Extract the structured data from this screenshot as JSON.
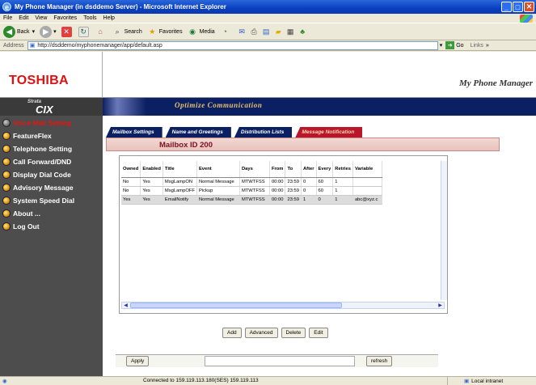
{
  "window": {
    "title": "My Phone Manager (in dsddemo Server) - Microsoft Internet Explorer",
    "min": "_",
    "max": "□",
    "close": "✕"
  },
  "menubar": [
    "File",
    "Edit",
    "View",
    "Favorites",
    "Tools",
    "Help"
  ],
  "toolbar": {
    "back": "Back",
    "search": "Search",
    "favorites": "Favorites",
    "media": "Media"
  },
  "addressbar": {
    "label": "Address",
    "url": "http://dsddemo/myphonemanager/app/default.asp",
    "go": "Go",
    "links": "Links"
  },
  "header": {
    "logo": "TOSHIBA",
    "app_title": "My Phone Manager",
    "strata_top": "Strata",
    "strata_cix": "CIX",
    "tagline": "Optimize Communication"
  },
  "nav": [
    {
      "label": "Voice Mail Setting",
      "active": true
    },
    {
      "label": "FeatureFlex",
      "active": false
    },
    {
      "label": "Telephone Setting",
      "active": false
    },
    {
      "label": "Call Forward/DND",
      "active": false
    },
    {
      "label": "Display Dial Code",
      "active": false
    },
    {
      "label": "Advisory Message",
      "active": false
    },
    {
      "label": "System Speed Dial",
      "active": false
    },
    {
      "label": "About ...",
      "active": false
    },
    {
      "label": "Log Out",
      "active": false
    }
  ],
  "tabs": [
    "Mailbox Settings",
    "Name and Greetings",
    "Distribution Lists",
    "Message Notification"
  ],
  "mailbox_label": "Mailbox ID 200",
  "table": {
    "columns": [
      "Owned",
      "Enabled",
      "Title",
      "Event",
      "Days",
      "From",
      "To",
      "After",
      "Every",
      "Retries",
      "Variable"
    ],
    "rows": [
      [
        "No",
        "Yes",
        "MsgLampON",
        "Normal Message",
        "MTWTFSS",
        "00:00",
        "23:59",
        "0",
        "60",
        "1",
        ""
      ],
      [
        "No",
        "Yes",
        "MsgLampOFF",
        "Pickup",
        "MTWTFSS",
        "00:00",
        "23:59",
        "0",
        "60",
        "1",
        ""
      ],
      [
        "Yes",
        "Yes",
        "EmailNotify",
        "Normal Message",
        "MTWTFSS",
        "00:00",
        "23:59",
        "1",
        "0",
        "1",
        "abc@xyz.c"
      ]
    ],
    "selected_row": 2
  },
  "buttons": {
    "add": "Add",
    "advanced": "Advanced",
    "delete": "Delete",
    "edit": "Edit",
    "apply": "Apply",
    "refresh": "refresh"
  },
  "status": {
    "text": "Connected to 159.119.113.180(SES) 159.119.113",
    "zone": "Local intranet"
  },
  "colors": {
    "banner": "#0b1f63",
    "nav_bg": "#4d4d4d",
    "active_tab": "#b9162b",
    "toshiba_red": "#e01010"
  }
}
